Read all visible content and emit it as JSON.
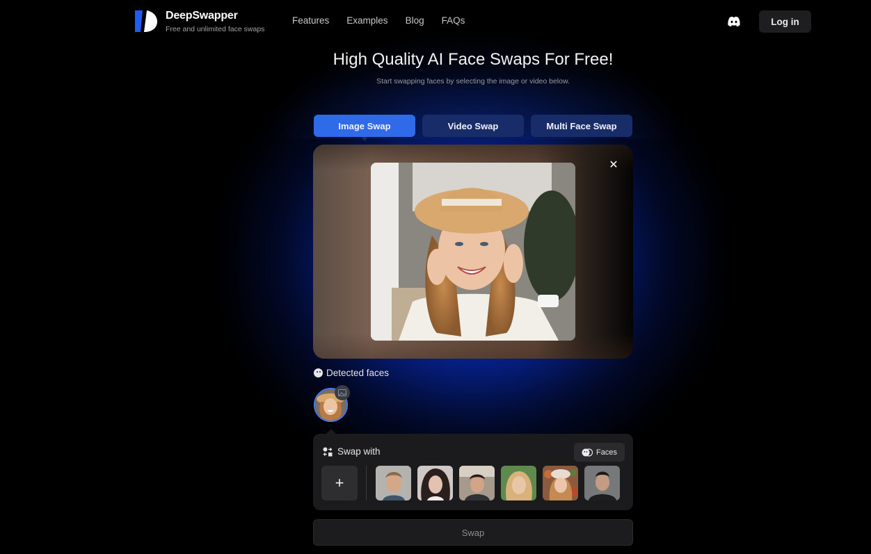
{
  "header": {
    "brand_name": "DeepSwapper",
    "brand_tagline": "Free and unlimited face swaps",
    "nav": [
      {
        "label": "Features"
      },
      {
        "label": "Examples"
      },
      {
        "label": "Blog"
      },
      {
        "label": "FAQs"
      }
    ],
    "discord_icon": "discord-icon",
    "login_label": "Log in"
  },
  "hero": {
    "title": "High Quality AI Face Swaps For Free!",
    "subtitle": "Start swapping faces by selecting the image or video below."
  },
  "tabs": [
    {
      "label": "Image Swap",
      "active": true
    },
    {
      "label": "Video Swap",
      "active": false
    },
    {
      "label": "Multi Face Swap",
      "active": false
    }
  ],
  "preview": {
    "close_icon": "close-icon",
    "close_glyph": "✕"
  },
  "detected_faces": {
    "label": "Detected faces",
    "count": 1
  },
  "swap_panel": {
    "label": "Swap with",
    "faces_button_label": "Faces",
    "add_glyph": "+",
    "face_options": [
      {
        "description": "man with short brown hair"
      },
      {
        "description": "woman with dark hair"
      },
      {
        "description": "man with dark hair outdoors"
      },
      {
        "description": "blonde woman green background"
      },
      {
        "description": "woman with beret floral background"
      },
      {
        "description": "bearded man dark hoodie"
      }
    ]
  },
  "swap_button_label": "Swap",
  "colors": {
    "accent": "#2f6ae8",
    "tab_inactive": "#182c6a",
    "glow": "#0a3ce6",
    "panel": "#1b1b1d"
  }
}
